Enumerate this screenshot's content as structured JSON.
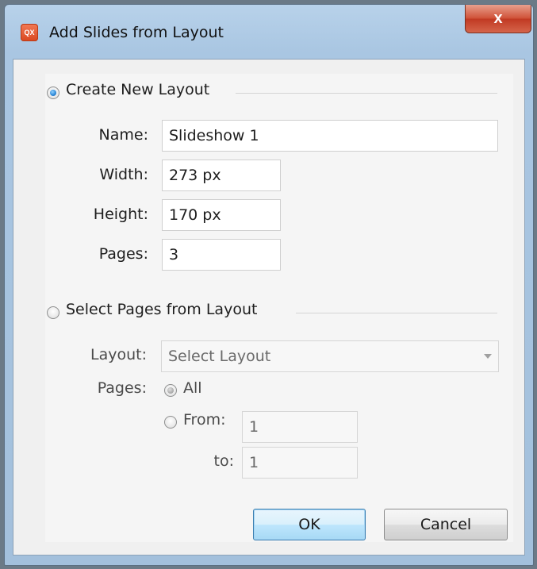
{
  "window": {
    "title": "Add Slides from Layout",
    "icon": "qx-app-icon",
    "close_label": "x"
  },
  "create_section": {
    "radio_label": "Create New Layout",
    "selected": true,
    "fields": {
      "name_label": "Name:",
      "name_value": "Slideshow 1",
      "width_label": "Width:",
      "width_value": "273 px",
      "height_label": "Height:",
      "height_value": "170 px",
      "pages_label": "Pages:",
      "pages_value": "3"
    }
  },
  "select_section": {
    "radio_label": "Select Pages from Layout",
    "selected": false,
    "layout_label": "Layout:",
    "layout_value": "Select Layout",
    "pages_label": "Pages:",
    "all_label": "All",
    "from_label": "From:",
    "from_value": "1",
    "to_label": "to:",
    "to_value": "1"
  },
  "buttons": {
    "ok": "OK",
    "cancel": "Cancel"
  }
}
